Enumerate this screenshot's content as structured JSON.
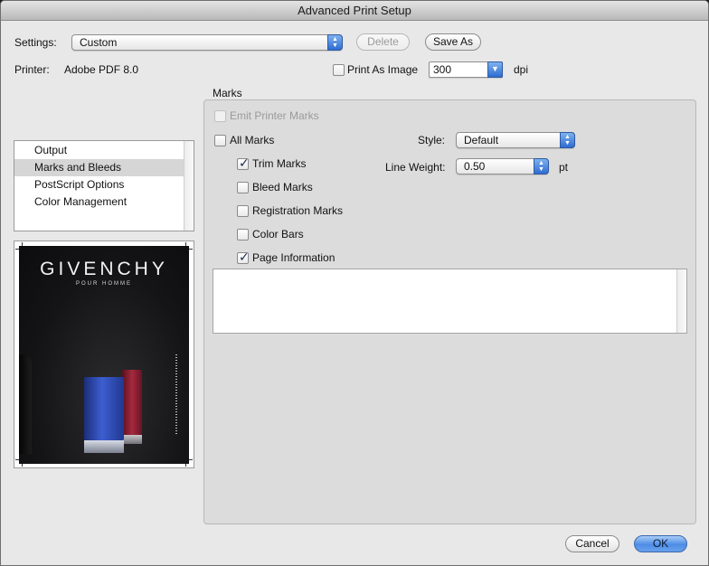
{
  "window": {
    "title": "Advanced Print Setup"
  },
  "settings": {
    "label": "Settings:",
    "value": "Custom",
    "delete_label": "Delete",
    "save_as_label": "Save As"
  },
  "printer": {
    "label": "Printer:",
    "value": "Adobe PDF 8.0",
    "print_as_image_label": "Print As Image",
    "print_as_image_checked": false,
    "dpi_value": "300",
    "dpi_unit": "dpi"
  },
  "sidebar": {
    "items": [
      {
        "label": "Output",
        "selected": false
      },
      {
        "label": "Marks and Bleeds",
        "selected": true
      },
      {
        "label": "PostScript Options",
        "selected": false
      },
      {
        "label": "Color Management",
        "selected": false
      }
    ]
  },
  "preview": {
    "brand": "GIVENCHY",
    "brand_sub": "POUR HOMME"
  },
  "marks": {
    "group_title": "Marks",
    "emit_printer_marks": {
      "label": "Emit Printer Marks",
      "checked": false,
      "enabled": false
    },
    "all_marks": {
      "label": "All Marks",
      "checked": false
    },
    "trim_marks": {
      "label": "Trim Marks",
      "checked": true
    },
    "bleed_marks": {
      "label": "Bleed Marks",
      "checked": false
    },
    "registration_marks": {
      "label": "Registration Marks",
      "checked": false
    },
    "color_bars": {
      "label": "Color Bars",
      "checked": false
    },
    "page_information": {
      "label": "Page Information",
      "checked": true
    },
    "style_label": "Style:",
    "style_value": "Default",
    "line_weight_label": "Line Weight:",
    "line_weight_value": "0.50",
    "line_weight_unit": "pt"
  },
  "footer": {
    "cancel_label": "Cancel",
    "ok_label": "OK"
  },
  "colors": {
    "accent": "#4d8ce6",
    "window_bg": "#e8e8e8",
    "panel_bg": "#dcdcdc"
  },
  "icons": {
    "popup_arrows": "up-down-chevron-icon",
    "combo_arrow": "chevron-down-icon",
    "check": "checkmark-icon"
  }
}
